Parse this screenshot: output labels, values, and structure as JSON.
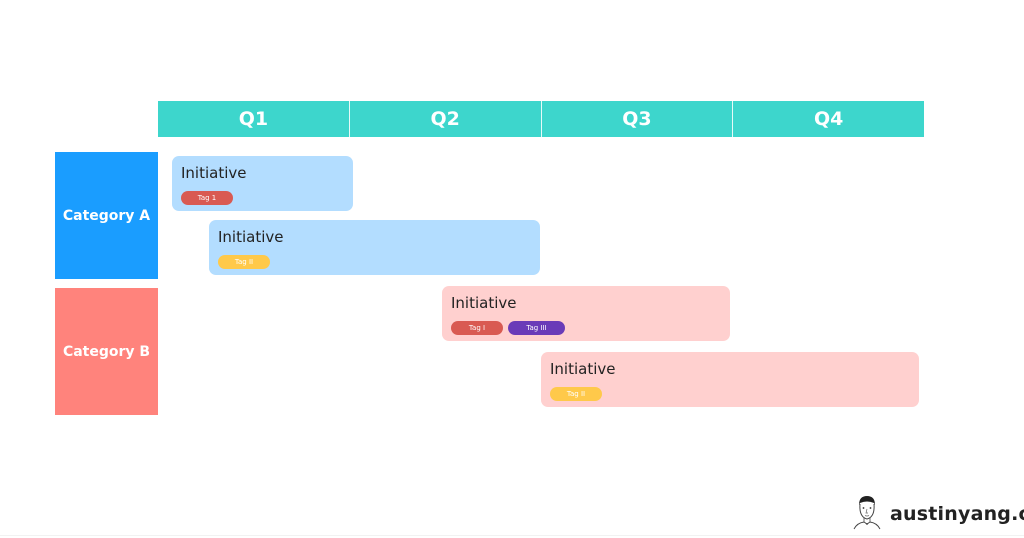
{
  "header": {
    "quarters": [
      "Q1",
      "Q2",
      "Q3",
      "Q4"
    ],
    "color": "#3dd6cc"
  },
  "categories": [
    {
      "label": "Category A",
      "color": "#1a9dff"
    },
    {
      "label": "Category B",
      "color": "#ff837c"
    }
  ],
  "initiatives": [
    {
      "title": "Initiative",
      "category": "Category A",
      "bg": "#b3ddff",
      "tags": [
        {
          "label": "Tag 1",
          "color": "#d95a52"
        }
      ]
    },
    {
      "title": "Initiative",
      "category": "Category A",
      "bg": "#b3ddff",
      "tags": [
        {
          "label": "Tag II",
          "color": "#ffc94a"
        }
      ]
    },
    {
      "title": "Initiative",
      "category": "Category B",
      "bg": "#ffd0cf",
      "tags": [
        {
          "label": "Tag I",
          "color": "#d95a52"
        },
        {
          "label": "Tag III",
          "color": "#6a3bb8"
        }
      ]
    },
    {
      "title": "Initiative",
      "category": "Category B",
      "bg": "#ffd0cf",
      "tags": [
        {
          "label": "Tag II",
          "color": "#ffc94a"
        }
      ]
    }
  ],
  "brand": {
    "text": "austinyang.co",
    "icon": "avatar-sketch-icon"
  }
}
